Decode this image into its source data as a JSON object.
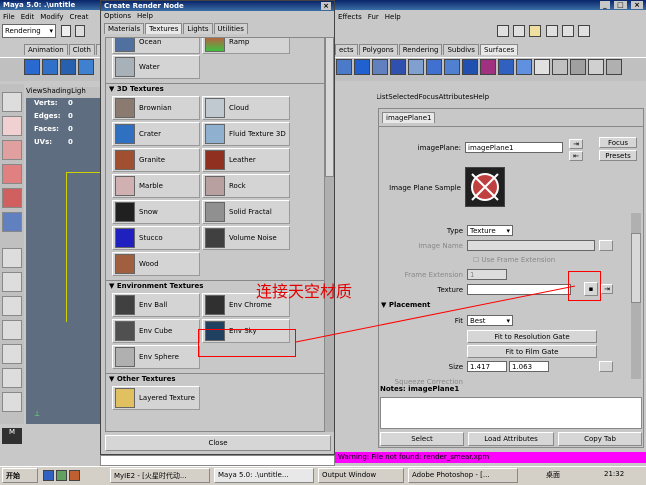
{
  "maya_title": "Maya 5.0: .\\untitle",
  "maya_menu": [
    "File",
    "Edit",
    "Modify",
    "Creat"
  ],
  "right_menu": [
    "Effects",
    "Fur",
    "Help"
  ],
  "rendering_select": "Rendering",
  "shelf_tabs": [
    "Animation",
    "Cloth",
    "Cu"
  ],
  "shelf_tabs_right": [
    "ects",
    "Polygons",
    "Rendering",
    "Subdivs",
    "Surfaces"
  ],
  "view_menu": [
    "View",
    "Shading",
    "Ligh"
  ],
  "hud": [
    {
      "label": "Verts:",
      "val": "0"
    },
    {
      "label": "Edges:",
      "val": "0"
    },
    {
      "label": "Faces:",
      "val": "0"
    },
    {
      "label": "UVs:",
      "val": "0"
    }
  ],
  "crn": {
    "title": "Create Render Node",
    "menu": [
      "Options",
      "Help"
    ],
    "tabs": [
      "Materials",
      "Textures",
      "Lights",
      "Utilities"
    ],
    "top_items": [
      "Ocean",
      "Ramp",
      "Water"
    ],
    "sec3d": "3D Textures",
    "items3d": [
      "Brownian",
      "Cloud",
      "Crater",
      "Fluid Texture 3D",
      "Granite",
      "Leather",
      "Marble",
      "Rock",
      "Snow",
      "Solid Fractal",
      "Stucco",
      "Volume Noise",
      "Wood"
    ],
    "secenv": "Environment Textures",
    "itemsenv": [
      "Env Ball",
      "Env Chrome",
      "Env Cube",
      "Env Sky",
      "Env Sphere"
    ],
    "secother": "Other Textures",
    "itemsother": [
      "Layered Texture"
    ],
    "close": "Close"
  },
  "annotation": "连接天空材质",
  "ae": {
    "menu": [
      "List",
      "Selected",
      "Focus",
      "Attributes",
      "Help"
    ],
    "tab": "imagePlane1",
    "node_label": "imagePlane:",
    "node_value": "imagePlane1",
    "focus": "Focus",
    "presets": "Presets",
    "sample_label": "Image Plane Sample",
    "type_label": "Type",
    "type_value": "Texture",
    "image_name_label": "Image Name",
    "use_frame_ext": "Use Frame Extension",
    "frame_ext_label": "Frame Extension",
    "frame_ext_value": "1",
    "texture_label": "Texture",
    "placement": "Placement",
    "fit_label": "Fit",
    "fit_value": "Best",
    "fit_res": "Fit to Resolution Gate",
    "fit_film": "Fit to Film Gate",
    "size_label": "Size",
    "size_x": "1.417",
    "size_y": "1.063",
    "squeeze_label": "Squeeze Correction",
    "squeeze_value": "1.000",
    "notes": "Notes: imagePlane1",
    "select": "Select",
    "load_attrs": "Load Attributes",
    "copy_tab": "Copy Tab"
  },
  "warning": "Warning: File not found: render_smear.xpm",
  "taskbar": {
    "start": "开始",
    "items": [
      "MyIE2 - [火星时代动...",
      "Maya 5.0: .\\untitle...",
      "Output Window",
      "Adobe Photoshop - [..."
    ],
    "desktop": "桌面",
    "clock": "21:32"
  },
  "colors": {
    "titlebar": "#0a246a",
    "annotation": "#e00000",
    "warning": "#ff00ff",
    "highlight": "#ff0000"
  }
}
